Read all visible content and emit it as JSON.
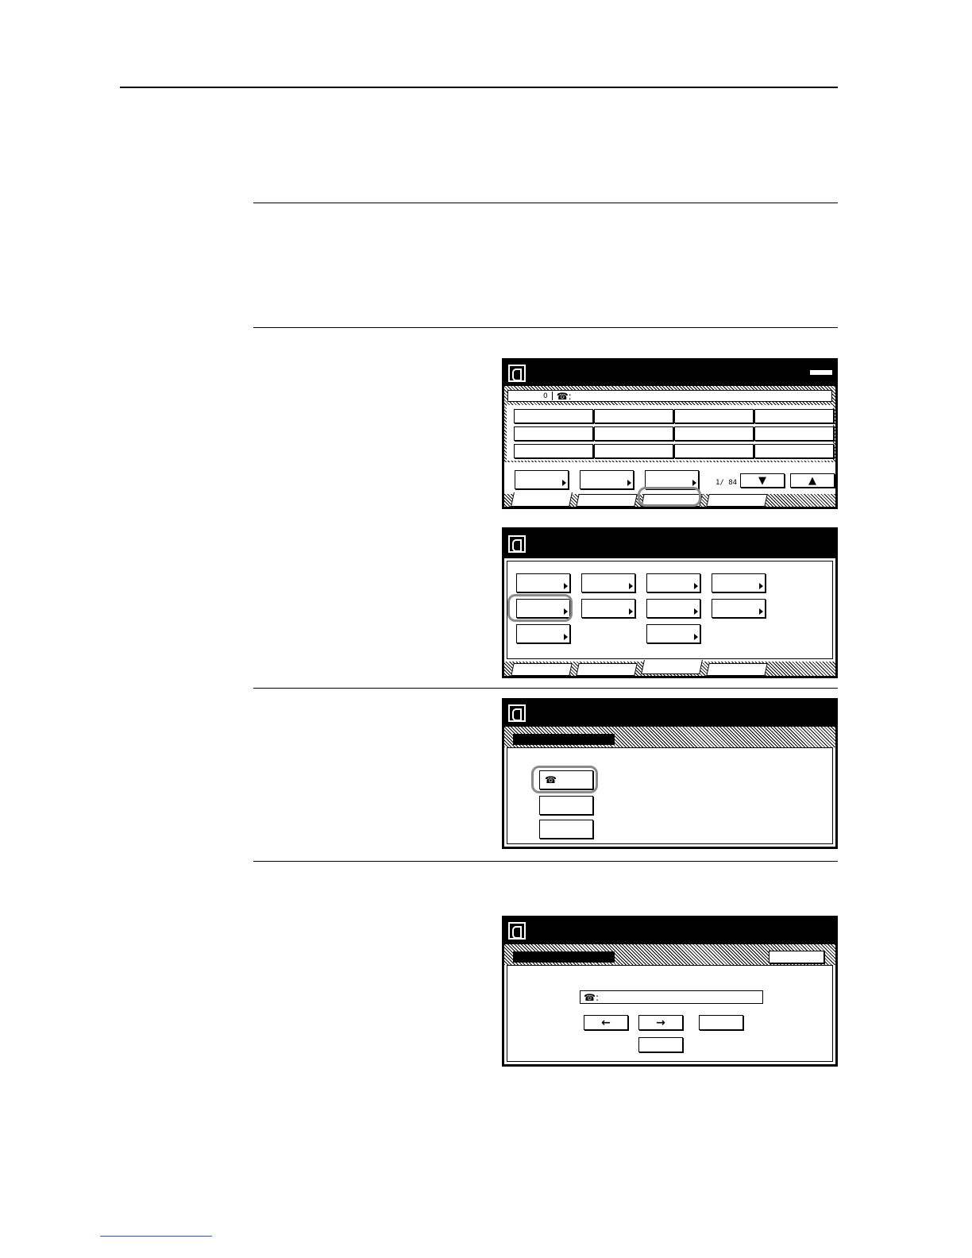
{
  "screen1": {
    "recipient_bar": {
      "count": "0",
      "phone_prefix": "☎:"
    },
    "page_indicator": "1/ 84",
    "scroll_down": "▼",
    "scroll_up": "▲"
  },
  "screen3": {
    "phone_button": "☎"
  },
  "screen4": {
    "phone_field_prefix": "☎:",
    "left_arrow": "←",
    "right_arrow": "→"
  },
  "colors": {
    "highlight_ring": "#8a8a8a",
    "panel_black": "#000000"
  }
}
